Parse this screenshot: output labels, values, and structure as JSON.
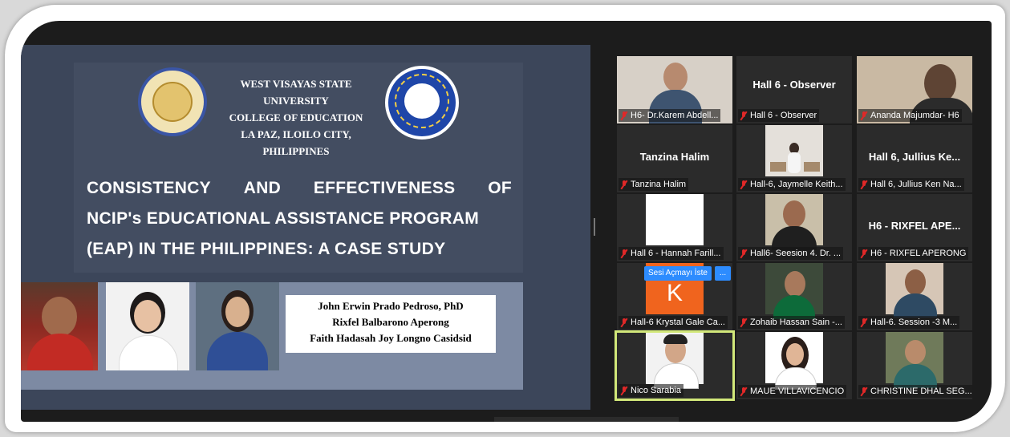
{
  "slide": {
    "university_line1": "WEST VISAYAS STATE UNIVERSITY",
    "university_line2": "COLLEGE OF EDUCATION",
    "university_line3": "LA PAZ, ILOILO CITY, PHILIPPINES",
    "title_l1_w1": "CONSISTENCY",
    "title_l1_w2": "AND",
    "title_l1_w3": "EFFECTIVENESS",
    "title_l1_w4": "OF",
    "title_line2": "NCIP's EDUCATIONAL ASSISTANCE PROGRAM",
    "title_line3": "(EAP) IN THE PHILIPPINES: A CASE STUDY",
    "authors": [
      "John Erwin Prado Pedroso, PhD",
      "Rixfel Balbarono Aperong",
      "Faith Hadasah Joy Longno Casidsid"
    ]
  },
  "participants": [
    {
      "label": "H6- Dr.Karem Abdell...",
      "display": ""
    },
    {
      "label": "Hall 6 - Observer",
      "display": "Hall 6 - Observer"
    },
    {
      "label": "Ananda Majumdar- H6",
      "display": ""
    },
    {
      "label": "Tanzina Halim",
      "display": "Tanzina Halim"
    },
    {
      "label": "Hall-6, Jaymelle Keith...",
      "display": ""
    },
    {
      "label": "Hall 6, Jullius Ken Na...",
      "display": "Hall 6, Jullius Ke..."
    },
    {
      "label": "Hall 6 - Hannah Farill...",
      "display": ""
    },
    {
      "label": "Hall6- Seesion 4. Dr. ...",
      "display": ""
    },
    {
      "label": "H6 - RIXFEL APERONG",
      "display": "H6 - RIXFEL APE..."
    },
    {
      "label": "Hall-6 Krystal Gale Ca...",
      "display": ""
    },
    {
      "label": "Zohaib Hassan Sain -...",
      "display": ""
    },
    {
      "label": "Hall-6. Session -3 M...",
      "display": ""
    },
    {
      "label": "Nico Sarabia",
      "display": ""
    },
    {
      "label": "MAUE VILLAVICENCIO",
      "display": ""
    },
    {
      "label": "CHRISTINE DHAL SEG...",
      "display": ""
    }
  ],
  "context_menu": {
    "unmute_request": "Sesi Açmayı İste",
    "more": "..."
  },
  "avatar_letter": "K",
  "colors": {
    "active_speaker_border": "#d2e87a",
    "mute_icon": "#e02828",
    "zoom_blue": "#2d8cff",
    "avatar_orange": "#f0641e"
  }
}
